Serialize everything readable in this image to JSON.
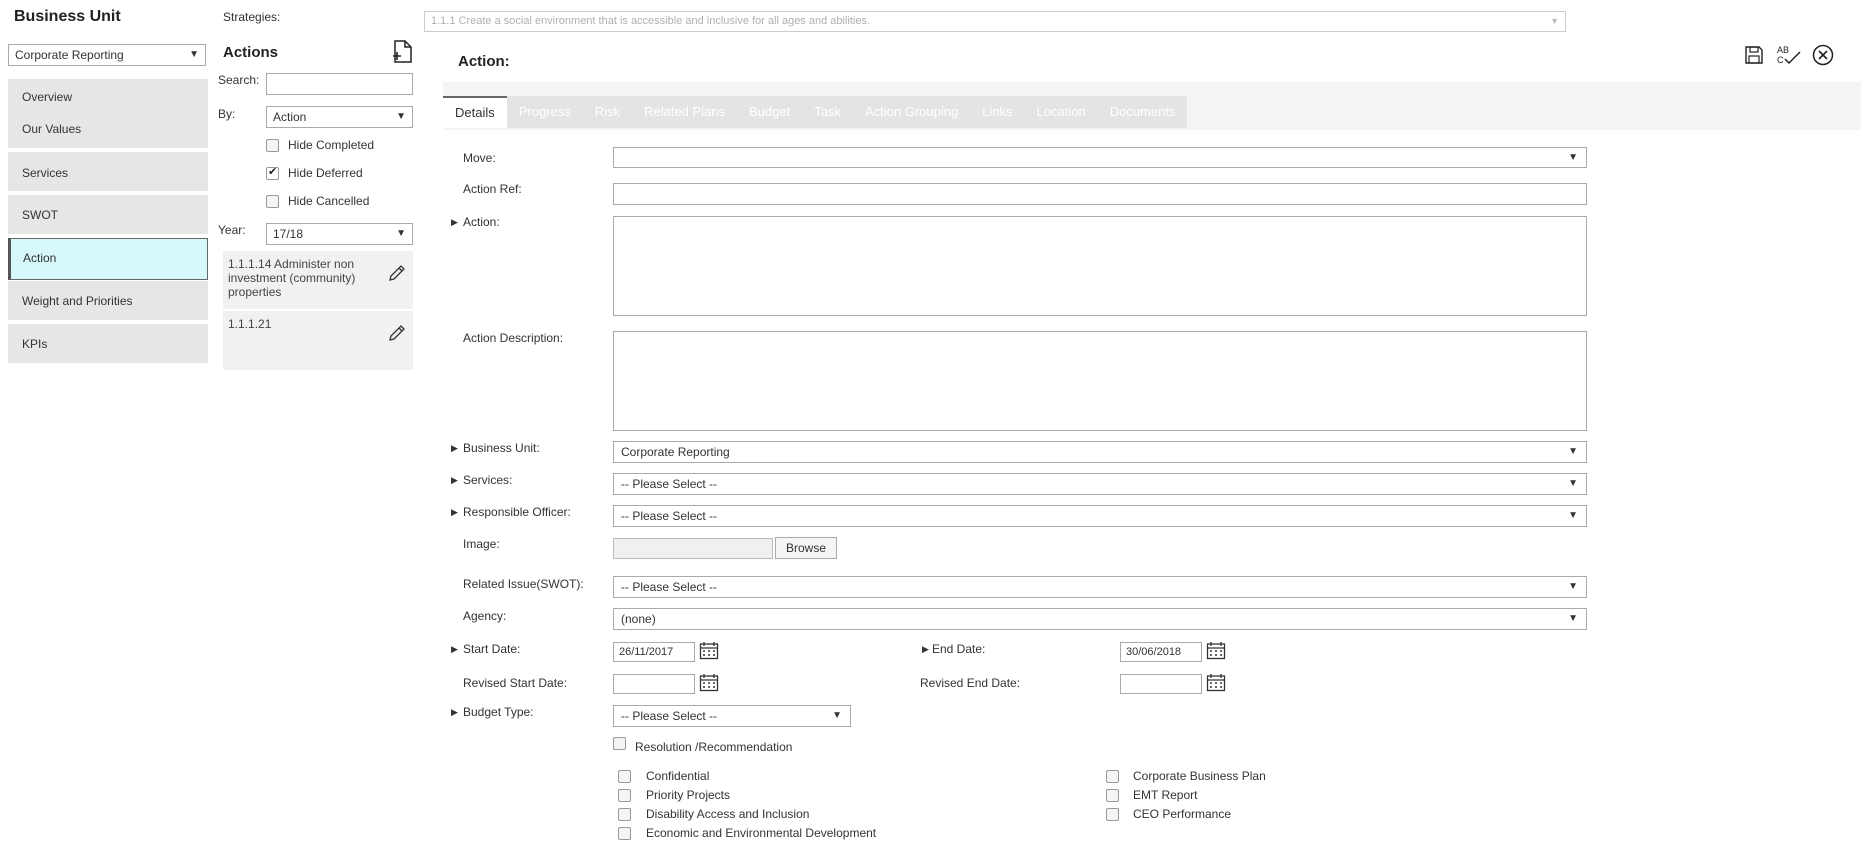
{
  "sidebar": {
    "title": "Business Unit",
    "selected_unit": "Corporate Reporting",
    "items": [
      {
        "label": "Overview"
      },
      {
        "label": "Our Values"
      },
      {
        "label": "Services"
      },
      {
        "label": "SWOT"
      },
      {
        "label": "Action"
      },
      {
        "label": "Weight and Priorities"
      },
      {
        "label": "KPIs"
      }
    ],
    "active_item": "Action"
  },
  "actions_panel": {
    "strategies_label": "Strategies:",
    "title": "Actions",
    "search_label": "Search:",
    "search_value": "",
    "by_label": "By:",
    "by_value": "Action",
    "hide_completed": {
      "label": "Hide Completed",
      "checked": false
    },
    "hide_deferred": {
      "label": "Hide Deferred",
      "checked": true
    },
    "hide_cancelled": {
      "label": "Hide Cancelled",
      "checked": false
    },
    "year_label": "Year:",
    "year_value": "17/18",
    "list": [
      {
        "text": "1.1.1.14 Administer non investment (community) properties"
      },
      {
        "text": "1.1.1.21"
      }
    ]
  },
  "main": {
    "strategy_value": "1.1.1 Create a social environment that is accessible and inclusive for all ages and abilities.",
    "heading": "Action:",
    "tabs": [
      {
        "label": "Details"
      },
      {
        "label": "Progress"
      },
      {
        "label": "Risk"
      },
      {
        "label": "Related Plans"
      },
      {
        "label": "Budget"
      },
      {
        "label": "Task"
      },
      {
        "label": "Action Grouping"
      },
      {
        "label": "Links"
      },
      {
        "label": "Location"
      },
      {
        "label": "Documents"
      }
    ],
    "active_tab": "Details",
    "form": {
      "move_label": "Move:",
      "move_value": "",
      "action_ref_label": "Action Ref:",
      "action_ref_value": "",
      "action_label": "Action:",
      "action_value": "",
      "action_description_label": "Action Description:",
      "action_description_value": "",
      "business_unit_label": "Business Unit:",
      "business_unit_value": "Corporate Reporting",
      "services_label": "Services:",
      "services_value": "-- Please Select --",
      "responsible_officer_label": "Responsible Officer:",
      "responsible_officer_value": "-- Please Select --",
      "image_label": "Image:",
      "browse_label": "Browse",
      "related_issue_label": "Related Issue(SWOT):",
      "related_issue_value": "-- Please Select --",
      "agency_label": "Agency:",
      "agency_value": "(none)",
      "start_date_label": "Start Date:",
      "start_date_value": "26/11/2017",
      "end_date_label": "End Date:",
      "end_date_value": "30/06/2018",
      "revised_start_label": "Revised Start Date:",
      "revised_start_value": "",
      "revised_end_label": "Revised End Date:",
      "revised_end_value": "",
      "budget_type_label": "Budget Type:",
      "budget_type_value": "-- Please Select --",
      "resolution_label": "Resolution /Recommendation",
      "checkboxes_left": [
        {
          "label": "Confidential"
        },
        {
          "label": "Priority Projects"
        },
        {
          "label": "Disability Access and Inclusion"
        },
        {
          "label": "Economic and Environmental Development"
        }
      ],
      "checkboxes_right": [
        {
          "label": "Corporate Business Plan"
        },
        {
          "label": "EMT Report"
        },
        {
          "label": "CEO Performance"
        }
      ]
    }
  },
  "icons": {
    "new_document": "new-document-icon",
    "edit": "pencil-icon",
    "save": "save-icon",
    "spellcheck": "spellcheck-icon",
    "close": "close-icon",
    "calendar": "calendar-icon",
    "expand": "expand-arrow-icon"
  },
  "colors": {
    "active_nav": "#d6f8fa",
    "nav_bg": "#e6e6e6",
    "tab_strip": "#e4e4e4"
  }
}
